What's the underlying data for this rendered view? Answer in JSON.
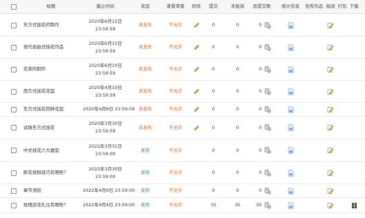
{
  "headers": {
    "title": "标题",
    "deadline": "截止时间",
    "status": "状态",
    "review": "查看审查",
    "edit": "修改",
    "submitted": "提交",
    "unreviewed": "未批阅",
    "total_submissions": "总提交数",
    "statistics": "统计信息",
    "excellent": "优秀作品",
    "review_action": "批阅",
    "pack": "打包",
    "download": "下载"
  },
  "rows": [
    {
      "title": "东方式插花的制作",
      "deadline_date": "2020年6月15日",
      "deadline_time": "23:59:59",
      "status": "未发布",
      "review": "不允许",
      "submitted": "0",
      "unreviewed": "0",
      "total": "0"
    },
    {
      "title": "现代自由式插花作品",
      "deadline_date": "2020年6月15日",
      "deadline_time": "23:59:59",
      "status": "未发布",
      "review": "不允许",
      "submitted": "0",
      "unreviewed": "0",
      "total": "0"
    },
    {
      "title": "花束的制作",
      "deadline_date": "2020年6月10日",
      "deadline_time": "23:59:59",
      "status": "未发布",
      "review": "不允许",
      "submitted": "0",
      "unreviewed": "0",
      "total": "0"
    },
    {
      "title": "西方式插花花型",
      "deadline_date": "2020年4月10日",
      "deadline_time": "23:59:59",
      "status": "未发布",
      "review": "不允许",
      "submitted": "0",
      "unreviewed": "0",
      "total": "0"
    },
    {
      "title": "东方式插花四种花型",
      "deadline_single": "2020年4月8日 23:59:59",
      "status": "未发布",
      "review": "不允许",
      "submitted": "0",
      "unreviewed": "0",
      "total": "0"
    },
    {
      "title": "试做东方式插花",
      "deadline_date": "2020年3月30日",
      "deadline_time": "23:59:59",
      "status": "未发布",
      "review": "不允许",
      "submitted": "0",
      "unreviewed": "0",
      "total": "0"
    },
    {
      "title": "中式插花六大器型",
      "deadline_date": "2022年3月31日",
      "deadline_time": "23:59:00",
      "status": "发布",
      "review": "不允许",
      "submitted": "0",
      "unreviewed": "0",
      "total": "0"
    },
    {
      "title": "鲜花保鲜技巧有哪些？",
      "deadline_date": "2022年3月30日",
      "deadline_time": "23:59:00",
      "status": "发布",
      "review": "不允许",
      "submitted": "0",
      "unreviewed": "0",
      "total": "0"
    },
    {
      "title": "章节测验",
      "deadline_single": "2022年4月9日 23:59:00",
      "status": "发布",
      "review": "不允许",
      "submitted": "0",
      "unreviewed": "0",
      "total": "0"
    },
    {
      "title": "玫瑰适花礼仪有哪些？",
      "deadline_single": "2022年4月4日 23:59:00",
      "status": "发布",
      "review": "不允许",
      "submitted": "35",
      "unreviewed": "35",
      "total": "35"
    }
  ],
  "colors": {
    "unpublished": "#e06a1c",
    "published": "#2f9e3a",
    "not_allowed": "#e06a1c",
    "pencil": "#e0a22a"
  },
  "icons": {
    "edit": "pencil-icon",
    "total": "submissions-icon",
    "statistics": "document-chart-icon",
    "review_action": "review-pen-icon",
    "download": "archive-icon"
  }
}
